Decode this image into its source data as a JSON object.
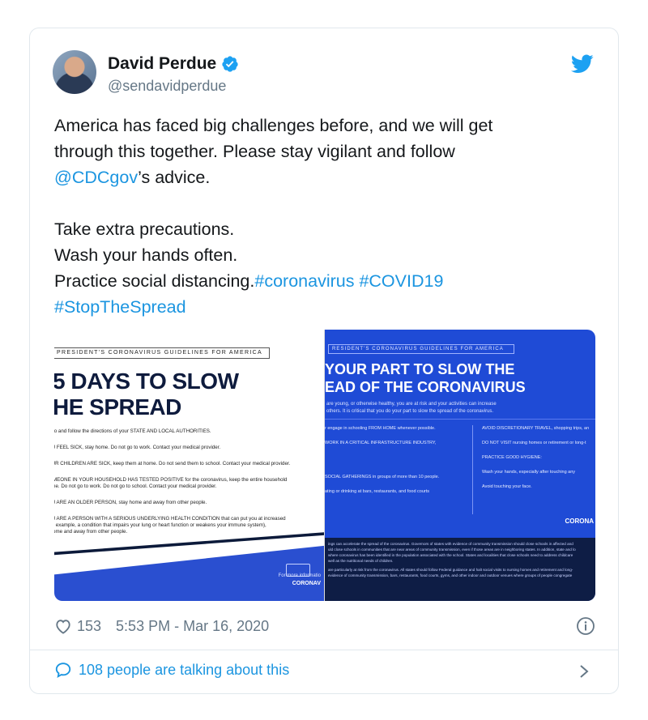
{
  "author": {
    "name": "David Perdue",
    "handle": "@sendavidperdue"
  },
  "tweet": {
    "line1": "America has faced big challenges before, and we will get",
    "line2": "through this together. Please stay vigilant and follow",
    "mention": "@CDCgov",
    "line3_rest": "’s advice.",
    "line4": "Take extra precautions.",
    "line5": "Wash your hands often.",
    "line6": "Practice social distancing.",
    "hashtag1": "#coronavirus",
    "hashtag2": "#COVID19",
    "hashtag3": "#StopTheSpread"
  },
  "media_left": {
    "header": "PRESIDENT'S CORONAVIRUS GUIDELINES FOR AMERICA",
    "title_line1": "5 DAYS TO SLOW",
    "title_line2": "HE SPREAD",
    "item1": "to and follow the directions of your STATE AND LOCAL AUTHORITIES.",
    "item2": "J FEEL SICK, stay home. Do not go to work. Contact your medical provider.",
    "item3": "JR CHILDREN ARE SICK, keep them at home. Do not send them to school. Contact your medical provider.",
    "item4": "MEONE IN YOUR HOUSEHOLD HAS TESTED POSITIVE for the coronavirus, keep the entire household",
    "item4b": "ne. Do not go to work. Do not go to school. Contact your medical provider.",
    "item5": "J ARE AN OLDER PERSON, stay home and away from other people.",
    "item6": "J ARE A PERSON WITH A SERIOUS UNDERLYING HEALTH CONDITION that can put you at increased",
    "item6b": "r example, a condition that impairs your lung or heart function or weakens your immune system),",
    "item6c": "ome and away from other people.",
    "more_info": "For more informatio",
    "more_info_brand": "CORONAV"
  },
  "media_right": {
    "header": "RESIDENT'S CORONAVIRUS GUIDELINES FOR AMERICA",
    "title_line1": "YOUR PART TO SLOW THE",
    "title_line2": "EAD OF THE CORONAVIRUS",
    "sub_line1": "are young, or otherwise healthy, you are at risk and your activities can increase",
    "sub_line2": "others. It is critical that you do your part to slow the spread of the coronavirus.",
    "col1_a": "r engage in schooling FROM HOME whenever possible.",
    "col1_b": "WORK IN A CRITICAL INFRASTRUCTURE INDUSTRY,",
    "col1_c": "SOCIAL GATHERINGS in groups of more than 10 people.",
    "col1_d": "ating or drinking at bars, restaurants, and food courts",
    "col2_a": "AVOID DISCRETIONARY TRAVEL, shopping trips, an",
    "col2_b": "DO NOT VISIT nursing homes or retirement or long-t",
    "col2_c": "PRACTICE GOOD HYGIENE:",
    "col2_d": "Wash your hands, especially after touching any",
    "col2_e": "Avoid touching your face.",
    "brand": "CORONA",
    "footer1": "ings can accelerate the spread of the coronavirus. Governors of states with evidence of community transmission should close schools in affected and",
    "footer2": "uld close schools in communities that are near areas of community transmission, even if those areas are in neighboring states. In addition, state and lo",
    "footer3": "where coronavirus has been identified in the population associated with the school. States and localities that close schools need to address childcare",
    "footer4": "well as the nutritional needs of children.",
    "footer5": "are particularly at risk from the coronavirus. All states should follow Federal guidance and halt social visits to nursing homes and retirement and long-",
    "footer6": "evidence of community transmission, bars, restaurants, food courts, gyms, and other indoor and outdoor venues where groups of people congregate"
  },
  "meta": {
    "likes": "153",
    "timestamp": "5:53 PM - Mar 16, 2020"
  },
  "footer": {
    "talking": "108 people are talking about this"
  },
  "colors": {
    "link": "#1b95e0",
    "twitter_blue": "#1da1f2",
    "muted": "#657786"
  }
}
